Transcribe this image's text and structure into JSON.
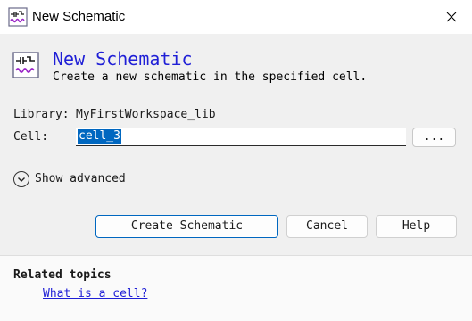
{
  "window": {
    "title": "New Schematic",
    "close_icon": "close-icon"
  },
  "header": {
    "title": "New Schematic",
    "subtitle": "Create a new schematic in the specified cell.",
    "icon": "schematic-icon"
  },
  "form": {
    "library_label": "Library:",
    "library_value": "MyFirstWorkspace_lib",
    "cell_label": "Cell:",
    "cell_value": "cell_3",
    "browse_label": "...",
    "advanced_label": "Show advanced",
    "advanced_icon": "chevron-down-icon"
  },
  "buttons": {
    "create": "Create Schematic",
    "cancel": "Cancel",
    "help": "Help"
  },
  "related": {
    "title": "Related topics",
    "link": "What is a cell?"
  },
  "colors": {
    "accent": "#1f1fd6",
    "selection": "#0067c0",
    "background": "#f0f0f0"
  }
}
